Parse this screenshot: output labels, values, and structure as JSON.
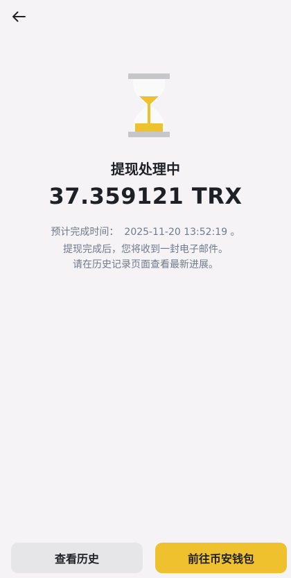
{
  "header": {
    "back_icon": "arrow-left-icon"
  },
  "status": {
    "icon": "hourglass-icon",
    "title": "提现处理中",
    "amount": "37.359121 TRX",
    "estimate_label": "预计完成时间：",
    "estimate_time": "2025-11-20 13:52:19 。",
    "notice_line1": "提现完成后，您将收到一封电子邮件。",
    "notice_line2": "请在历史记录页面查看最新进展。"
  },
  "actions": {
    "history_label": "查看历史",
    "wallet_label": "前往币安钱包"
  },
  "colors": {
    "accent": "#F0C12E",
    "background": "#F5F3F6",
    "secondary_button": "#E6E6E8",
    "muted_text": "#707A8A",
    "hourglass_frame": "#C7C7CA"
  }
}
